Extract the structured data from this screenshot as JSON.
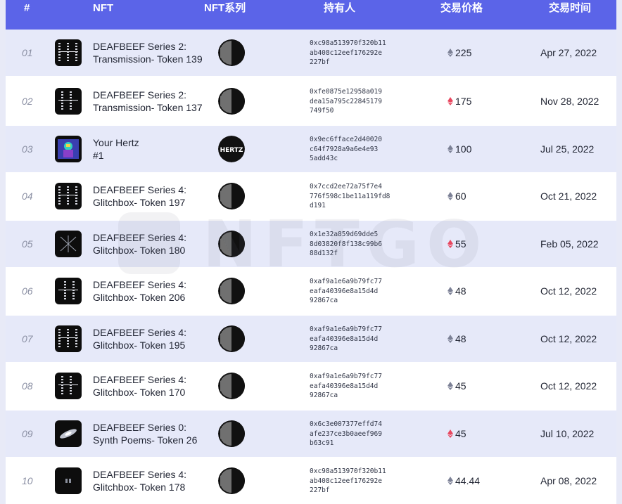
{
  "header": {
    "rank_label": "#",
    "nft_label": "NFT",
    "series_label": "NFT系列",
    "holder_label": "持有人",
    "price_label": "交易价格",
    "time_label": "交易时间"
  },
  "watermark": {
    "text": "NFTGO"
  },
  "colors": {
    "header_bg": "#5b64e8",
    "row_alt": "#e6e9f9",
    "eth_grey": "#7c8196",
    "eth_red": "#e8475f"
  },
  "rows": [
    {
      "rank": "01",
      "name1": "DEAFBEEF Series 2:",
      "name2": "Transmission- Token 139",
      "series_icon": "half-circle-icon",
      "holder1": "0xc98a513970f320b11",
      "holder2": "ab408c12eef176292e",
      "holder3": "227bf",
      "eth": "grey",
      "price": "225",
      "date": "Apr 27, 2022"
    },
    {
      "rank": "02",
      "name1": "DEAFBEEF Series 2:",
      "name2": "Transmission- Token 137",
      "series_icon": "half-circle-icon",
      "holder1": "0xfe0875e12958a019",
      "holder2": "dea15a795c22845179",
      "holder3": "749f50",
      "eth": "red",
      "price": "175",
      "date": "Nov 28, 2022"
    },
    {
      "rank": "03",
      "name1": "Your Hertz",
      "name2": "#1",
      "series_icon": "hertz-logo-icon",
      "series_text": "HERTZ",
      "holder1": "0x9ec6fface2d40020",
      "holder2": "c64f7928a9a6e4e93",
      "holder3": "5add43c",
      "eth": "grey",
      "price": "100",
      "date": "Jul 25, 2022"
    },
    {
      "rank": "04",
      "name1": "DEAFBEEF Series 4:",
      "name2": "Glitchbox- Token 197",
      "series_icon": "half-circle-icon",
      "holder1": "0x7ccd2ee72a75f7e4",
      "holder2": "776f598c1be11a119fd8",
      "holder3": "d191",
      "eth": "grey",
      "price": "60",
      "date": "Oct 21, 2022"
    },
    {
      "rank": "05",
      "name1": "DEAFBEEF Series 4:",
      "name2": "Glitchbox- Token 180",
      "series_icon": "half-circle-icon",
      "holder1": "0x1e32a859d69dde5",
      "holder2": "8d03820f8f138c99b6",
      "holder3": "88d132f",
      "eth": "red",
      "price": "55",
      "date": "Feb 05, 2022"
    },
    {
      "rank": "06",
      "name1": "DEAFBEEF Series 4:",
      "name2": "Glitchbox- Token 206",
      "series_icon": "half-circle-icon",
      "holder1": "0xaf9a1e6a9b79fc77",
      "holder2": "eafa40396e8a15d4d",
      "holder3": "92867ca",
      "eth": "grey",
      "price": "48",
      "date": "Oct 12, 2022"
    },
    {
      "rank": "07",
      "name1": "DEAFBEEF Series 4:",
      "name2": "Glitchbox- Token 195",
      "series_icon": "half-circle-icon",
      "holder1": "0xaf9a1e6a9b79fc77",
      "holder2": "eafa40396e8a15d4d",
      "holder3": "92867ca",
      "eth": "grey",
      "price": "48",
      "date": "Oct 12, 2022"
    },
    {
      "rank": "08",
      "name1": "DEAFBEEF Series 4:",
      "name2": "Glitchbox- Token 170",
      "series_icon": "half-circle-icon",
      "holder1": "0xaf9a1e6a9b79fc77",
      "holder2": "eafa40396e8a15d4d",
      "holder3": "92867ca",
      "eth": "grey",
      "price": "45",
      "date": "Oct 12, 2022"
    },
    {
      "rank": "09",
      "name1": "DEAFBEEF Series 0:",
      "name2": "Synth Poems- Token 26",
      "series_icon": "half-circle-icon",
      "holder1": "0x6c3e007377effd74",
      "holder2": "afe237ce3b0aeef969",
      "holder3": "b63c91",
      "eth": "red",
      "price": "45",
      "date": "Jul 10, 2022"
    },
    {
      "rank": "10",
      "name1": "DEAFBEEF Series 4:",
      "name2": "Glitchbox- Token 178",
      "series_icon": "half-circle-icon",
      "holder1": "0xc98a513970f320b11",
      "holder2": "ab408c12eef176292e",
      "holder3": "227bf",
      "eth": "grey",
      "price": "44.44",
      "date": "Apr 08, 2022"
    }
  ]
}
